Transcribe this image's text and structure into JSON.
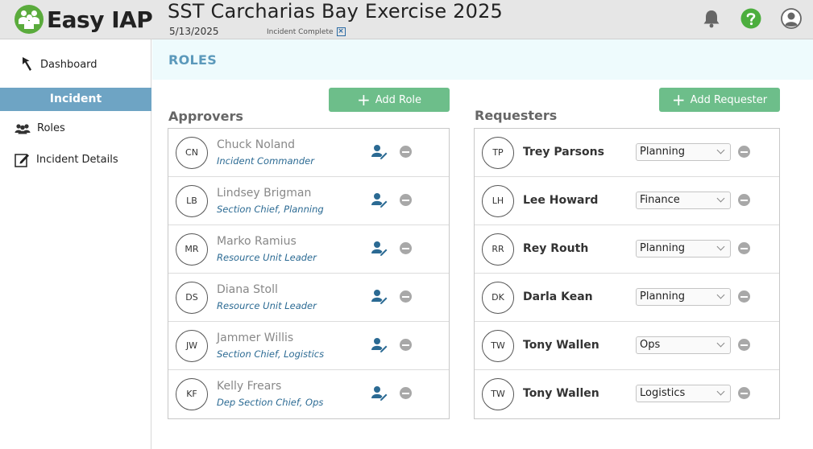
{
  "header": {
    "brand": "Easy IAP",
    "title": "SST Carcharias Bay Exercise 2025",
    "date": "5/13/2025",
    "status": "Incident Complete",
    "status_close": "×"
  },
  "sidebar": {
    "dashboard": "Dashboard",
    "section": "Incident",
    "items": [
      {
        "label": "Roles",
        "icon": "people-icon"
      },
      {
        "label": "Incident Details",
        "icon": "edit-document-icon"
      }
    ]
  },
  "page": {
    "title": "ROLES"
  },
  "approvers": {
    "title": "Approvers",
    "add_label": "Add Role",
    "rows": [
      {
        "initials": "CN",
        "name": "Chuck Noland",
        "role": "Incident Commander"
      },
      {
        "initials": "LB",
        "name": "Lindsey Brigman",
        "role": "Section Chief, Planning"
      },
      {
        "initials": "MR",
        "name": "Marko Ramius",
        "role": "Resource Unit Leader"
      },
      {
        "initials": "DS",
        "name": "Diana Stoll",
        "role": "Resource Unit Leader"
      },
      {
        "initials": "JW",
        "name": "Jammer Willis",
        "role": "Section Chief, Logistics"
      },
      {
        "initials": "KF",
        "name": "Kelly Frears",
        "role": "Dep Section Chief, Ops"
      }
    ]
  },
  "requesters": {
    "title": "Requesters",
    "add_label": "Add Requester",
    "rows": [
      {
        "initials": "TP",
        "name": "Trey Parsons",
        "section": "Planning"
      },
      {
        "initials": "LH",
        "name": "Lee Howard",
        "section": "Finance"
      },
      {
        "initials": "RR",
        "name": "Rey Routh",
        "section": "Planning"
      },
      {
        "initials": "DK",
        "name": "Darla Kean",
        "section": "Planning"
      },
      {
        "initials": "TW",
        "name": "Tony Wallen",
        "section": "Ops"
      },
      {
        "initials": "TW",
        "name": "Tony Wallen",
        "section": "Logistics"
      }
    ]
  },
  "colors": {
    "accent": "#6ea4c4",
    "button": "#6dbe8a",
    "role_text": "#2b6a93",
    "logo_green": "#5aab3c",
    "help_green": "#4cae3e"
  }
}
